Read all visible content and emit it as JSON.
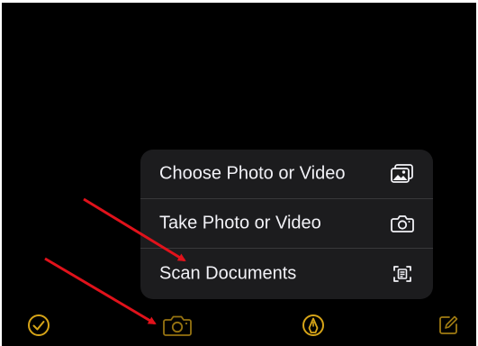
{
  "colors": {
    "background": "#000000",
    "menu_background": "#1c1c1e",
    "menu_text": "#f2f2f7",
    "separator": "#38383a",
    "accent": "#d6a418",
    "annotation_arrow": "#e0121b"
  },
  "menu": {
    "items": [
      {
        "label": "Choose Photo or Video",
        "icon": "photo-library-icon"
      },
      {
        "label": "Take Photo or Video",
        "icon": "camera-icon"
      },
      {
        "label": "Scan Documents",
        "icon": "document-scan-icon"
      }
    ]
  },
  "toolbar": {
    "items": [
      {
        "icon": "checklist-icon"
      },
      {
        "icon": "camera-icon",
        "state": "active"
      },
      {
        "icon": "markup-pen-icon"
      },
      {
        "icon": "compose-icon"
      }
    ]
  },
  "annotations": [
    {
      "type": "arrow",
      "points_to": "Scan Documents"
    },
    {
      "type": "arrow",
      "points_to": "camera toolbar button"
    }
  ]
}
